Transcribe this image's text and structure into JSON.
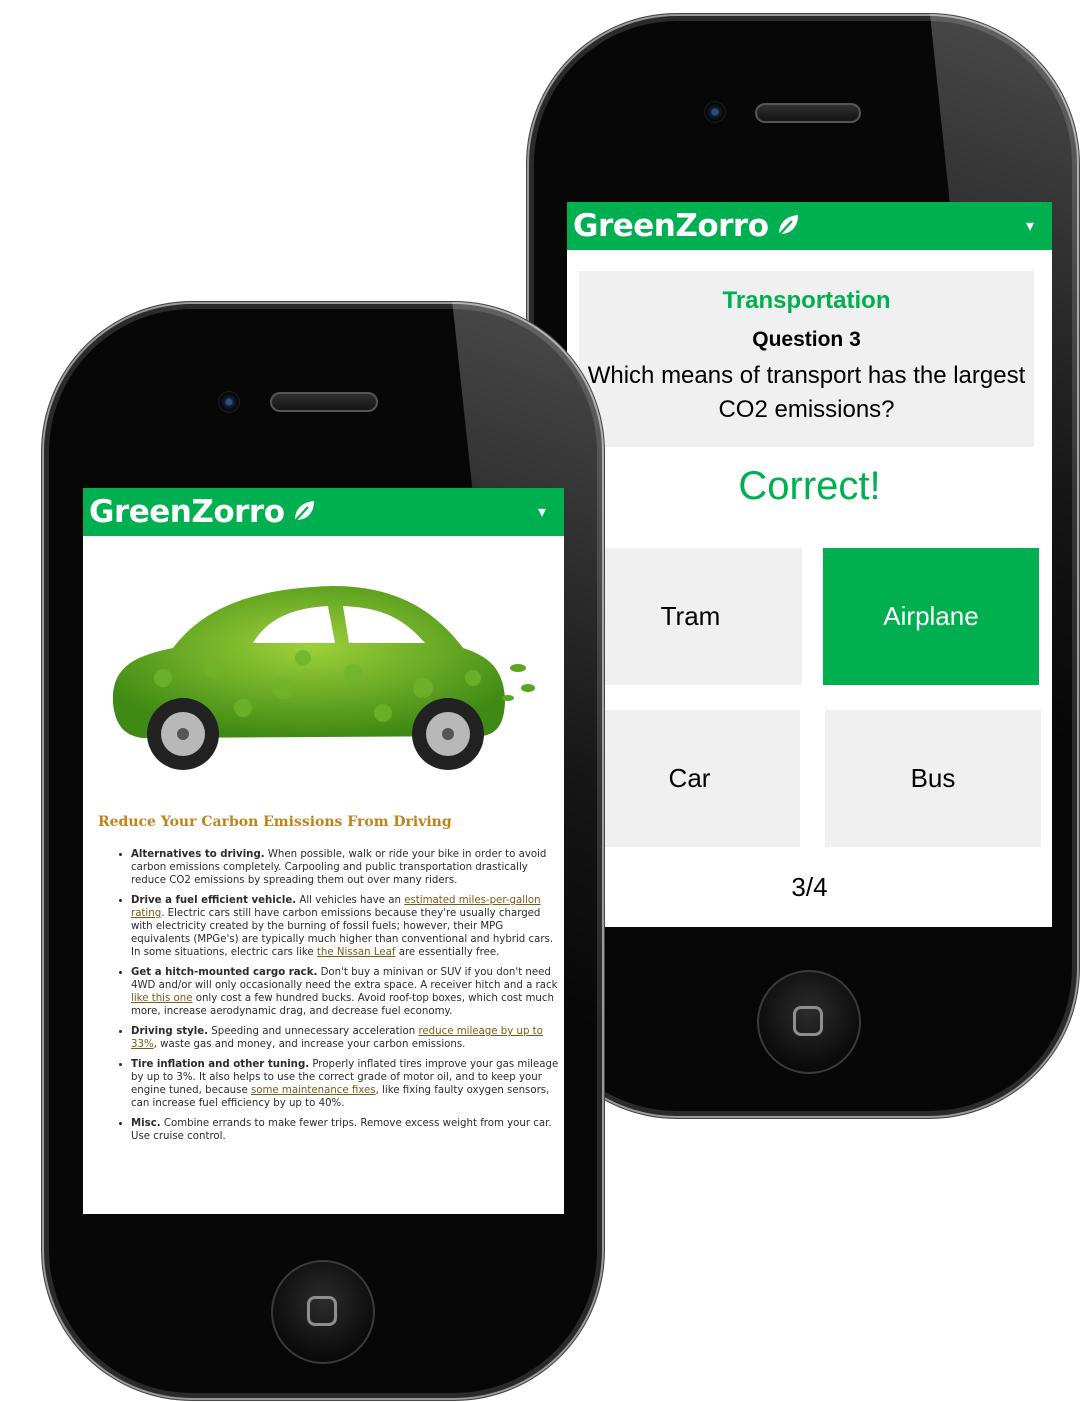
{
  "brand_color": "#00b050",
  "article_phone": {
    "app_bar": {
      "brand": "GreenZorro",
      "leaf_icon": "leaf-icon",
      "menu_icon": "▾"
    },
    "article": {
      "image": "car-made-of-leaves",
      "title": "Reduce Your Carbon Emissions From Driving",
      "tips": [
        {
          "head": "Alternatives to driving.",
          "body": " When possible, walk or ride your bike in order to avoid carbon emissions completely. Carpooling and public transportation drastically reduce CO2 emissions by spreading them out over many riders."
        },
        {
          "head": "Drive a fuel efficient vehicle.",
          "body": " All vehicles have an ",
          "link1": "estimated miles-per-gallon rating",
          "body2": ". Electric cars still have carbon emissions because they're usually charged with electricity created by the burning of fossil fuels; however, their MPG equivalents (MPGe's) are typically much higher than conventional and hybrid cars. In some situations, electric cars like ",
          "link2": "the Nissan Leaf",
          "body3": " are essentially free."
        },
        {
          "head": "Get a hitch-mounted cargo rack.",
          "body": " Don't buy a minivan or SUV if you don't need 4WD and/or will only occasionally need the extra space. A receiver hitch and a rack ",
          "link1": "like this one",
          "body2": " only cost a few hundred bucks. Avoid roof-top boxes, which cost much more, increase aerodynamic drag, and decrease fuel economy."
        },
        {
          "head": "Driving style.",
          "body": " Speeding and unnecessary acceleration ",
          "link1": "reduce mileage by up to 33%",
          "body2": ", waste gas and money, and increase your carbon emissions."
        },
        {
          "head": "Tire inflation and other tuning.",
          "body": " Properly inflated tires improve your gas mileage by up to 3%. It also helps to use the correct grade of motor oil, and to keep your engine tuned, because ",
          "link1": "some maintenance fixes",
          "body2": ", like fixing faulty oxygen sensors, can increase fuel efficiency by up to 40%."
        },
        {
          "head": "Misc.",
          "body": " Combine errands to make fewer trips. Remove excess weight from your car. Use cruise control."
        }
      ]
    }
  },
  "quiz_phone": {
    "app_bar": {
      "brand": "GreenZorro",
      "leaf_icon": "leaf-icon",
      "menu_icon": "▾"
    },
    "quiz": {
      "category": "Transportation",
      "question_number": "Question 3",
      "question": "Which means of transport has the largest CO2 emissions?",
      "result": "Correct!",
      "answers": [
        {
          "label": "Tram",
          "correct": false
        },
        {
          "label": "Airplane",
          "correct": true
        },
        {
          "label": "Car",
          "correct": false
        },
        {
          "label": "Bus",
          "correct": false
        }
      ],
      "progress": "3/4"
    }
  }
}
